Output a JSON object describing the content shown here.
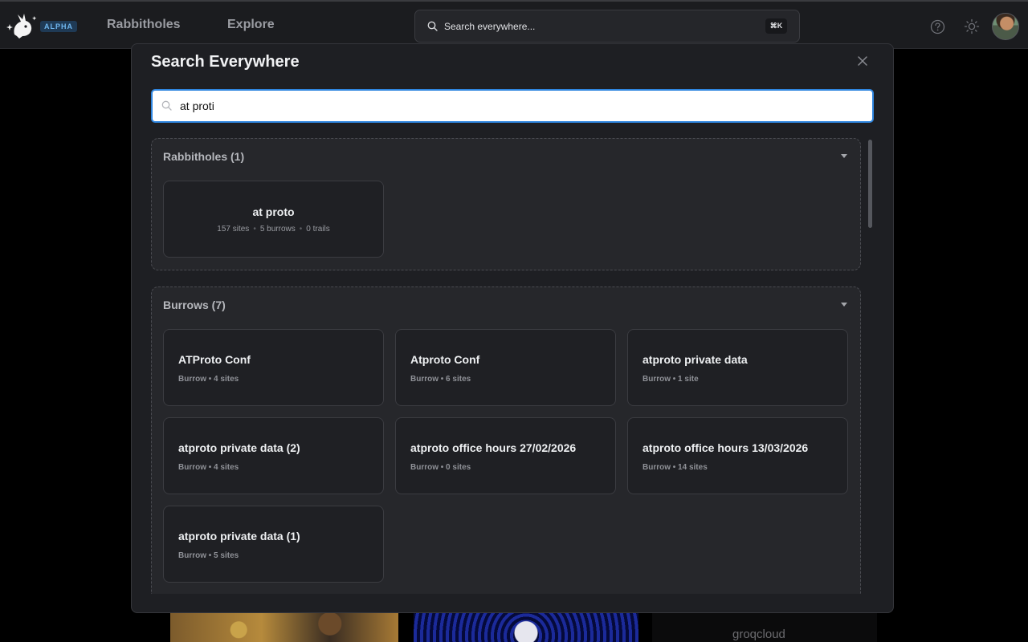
{
  "topbar": {
    "badge": "ALPHA",
    "nav": [
      {
        "label": "Rabbitholes"
      },
      {
        "label": "Explore"
      }
    ],
    "search_placeholder": "Search everywhere...",
    "shortcut": "⌘K"
  },
  "background": {
    "partial_text": "groqcloud"
  },
  "modal": {
    "title": "Search Everywhere",
    "query": "at proti",
    "rabbitholes": {
      "title": "Rabbitholes (1)",
      "items": [
        {
          "name": "at proto",
          "sites": "157 sites",
          "burrows": "5 burrows",
          "trails": "0 trails"
        }
      ]
    },
    "burrows": {
      "title": "Burrows (7)",
      "items": [
        {
          "name": "ATProto Conf",
          "meta": "Burrow • 4 sites"
        },
        {
          "name": "Atproto Conf",
          "meta": "Burrow • 6 sites"
        },
        {
          "name": "atproto private data",
          "meta": "Burrow • 1 site"
        },
        {
          "name": "atproto private data (2)",
          "meta": "Burrow • 4 sites"
        },
        {
          "name": "atproto office hours 27/02/2026",
          "meta": "Burrow • 0 sites"
        },
        {
          "name": "atproto office hours 13/03/2026",
          "meta": "Burrow • 14 sites"
        },
        {
          "name": "atproto private data (1)",
          "meta": "Burrow • 5 sites"
        }
      ]
    }
  }
}
